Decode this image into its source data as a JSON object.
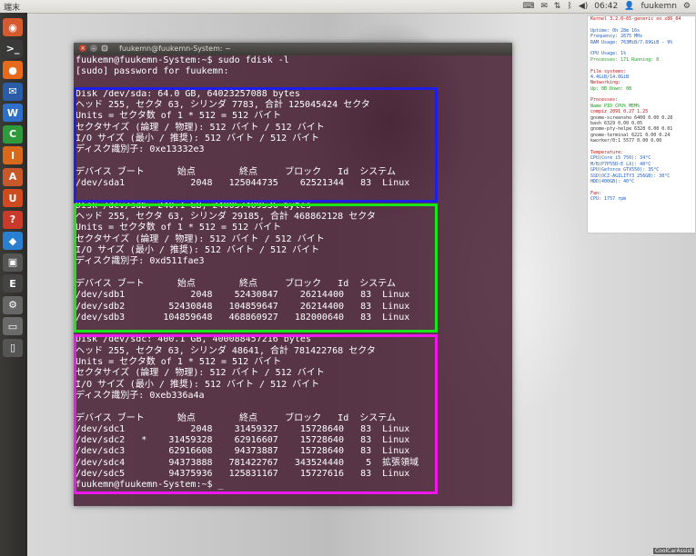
{
  "top_panel": {
    "app_title": "端末",
    "time": "06:42",
    "user": "fuukemn",
    "icons": [
      "keyboard-icon",
      "mail-icon",
      "network-icon",
      "bluetooth-icon",
      "volume-icon",
      "power-icon"
    ]
  },
  "launcher": {
    "items": [
      {
        "name": "dash-home",
        "glyph": "◉",
        "color": "#d65a2f"
      },
      {
        "name": "terminal",
        "glyph": ">_",
        "color": "#3a3a3a"
      },
      {
        "name": "firefox",
        "glyph": "●",
        "color": "#e66a1c"
      },
      {
        "name": "thunderbird",
        "glyph": "✉",
        "color": "#2a5ca8"
      },
      {
        "name": "writer",
        "glyph": "W",
        "color": "#2e6fc9"
      },
      {
        "name": "calc",
        "glyph": "C",
        "color": "#2e9a3c"
      },
      {
        "name": "impress",
        "glyph": "I",
        "color": "#d8691a"
      },
      {
        "name": "software-center",
        "glyph": "A",
        "color": "#c8582a"
      },
      {
        "name": "ubuntu-one",
        "glyph": "U",
        "color": "#d04a20"
      },
      {
        "name": "help",
        "glyph": "?",
        "color": "#c83a2a"
      },
      {
        "name": "dropbox",
        "glyph": "◆",
        "color": "#2a7fd0"
      },
      {
        "name": "screenshot",
        "glyph": "▣",
        "color": "#555555"
      },
      {
        "name": "editor",
        "glyph": "E",
        "color": "#444444"
      },
      {
        "name": "settings",
        "glyph": "⚙",
        "color": "#666666"
      },
      {
        "name": "drive",
        "glyph": "▭",
        "color": "#6a6a6a"
      },
      {
        "name": "trash",
        "glyph": "▯",
        "color": "#555555"
      }
    ]
  },
  "terminal": {
    "title": "fuukemn@fuukemn-System: ~",
    "lines": [
      "fuukemn@fuukemn-System:~$ sudo fdisk -l",
      "[sudo] password for fuukemn:",
      "",
      "Disk /dev/sda: 64.0 GB, 64023257088 bytes",
      "ヘッド 255, セクタ 63, シリンダ 7783, 合計 125045424 セクタ",
      "Units = セクタ数 of 1 * 512 = 512 バイト",
      "セクタサイズ (論理 / 物理): 512 バイト / 512 バイト",
      "I/O サイズ (最小 / 推奨): 512 バイト / 512 バイト",
      "ディスク識別子: 0xe13332e3",
      "",
      "デバイス ブート      始点        終点     ブロック   Id  システム",
      "/dev/sda1            2048   125044735    62521344   83  Linux",
      "",
      "Disk /dev/sdb: 240.1 GB, 240057409536 bytes",
      "ヘッド 255, セクタ 63, シリンダ 29185, 合計 468862128 セクタ",
      "Units = セクタ数 of 1 * 512 = 512 バイト",
      "セクタサイズ (論理 / 物理): 512 バイト / 512 バイト",
      "I/O サイズ (最小 / 推奨): 512 バイト / 512 バイト",
      "ディスク識別子: 0xd511fae3",
      "",
      "デバイス ブート      始点        終点     ブロック   Id  システム",
      "/dev/sdb1            2048    52430847    26214400   83  Linux",
      "/dev/sdb2        52430848   104859647    26214400   83  Linux",
      "/dev/sdb3       104859648   468860927   182000640   83  Linux",
      "",
      "Disk /dev/sdc: 400.1 GB, 400088457216 bytes",
      "ヘッド 255, セクタ 63, シリンダ 48641, 合計 781422768 セクタ",
      "Units = セクタ数 of 1 * 512 = 512 バイト",
      "セクタサイズ (論理 / 物理): 512 バイト / 512 バイト",
      "I/O サイズ (最小 / 推奨): 512 バイト / 512 バイト",
      "ディスク識別子: 0xeb336a4a",
      "",
      "デバイス ブート      始点        終点     ブロック   Id  システム",
      "/dev/sdc1            2048    31459327    15728640   83  Linux",
      "/dev/sdc2   *    31459328    62916607    15728640   83  Linux",
      "/dev/sdc3        62916608    94373887    15728640   83  Linux",
      "/dev/sdc4        94373888   781422767   343524440    5  拡張領域",
      "/dev/sdc5        94375936   125831167    15727616   83  Linux",
      "fuukemn@fuukemn-System:~$ _"
    ]
  },
  "conky": {
    "rows": [
      {
        "cls": "hdr",
        "text": "Kernel 3.2.0-65-generic on x86_64"
      },
      {
        "cls": "",
        "text": ""
      },
      {
        "cls": "lbl",
        "text": "Uptime:        0h 28m 16s"
      },
      {
        "cls": "lbl",
        "text": "Frequency:     2675 MHz"
      },
      {
        "cls": "lbl",
        "text": "RAM Usage:  763MiB/7.69GiB - 9%"
      },
      {
        "cls": "",
        "text": ""
      },
      {
        "cls": "lbl",
        "text": "CPU Usage: 1%"
      },
      {
        "cls": "grn",
        "text": "Processes: 171  Running: 0"
      },
      {
        "cls": "",
        "text": ""
      },
      {
        "cls": "hdr",
        "text": "File systems:"
      },
      {
        "cls": "lbl",
        "text": "  4.4GiB/14.0GiB"
      },
      {
        "cls": "hdr",
        "text": "Networking:"
      },
      {
        "cls": "grn",
        "text": "        Up: 0B   Down: 0B"
      },
      {
        "cls": "",
        "text": ""
      },
      {
        "cls": "hdr",
        "text": "Processes:"
      },
      {
        "cls": "grn",
        "text": "Name            PID  CPU%  MEM%"
      },
      {
        "cls": "hdr",
        "text": "compiz         2091  0.27  1.25"
      },
      {
        "cls": "",
        "text": "gnome-screensho 6400  0.00  0.28"
      },
      {
        "cls": "",
        "text": "bash            6329  0.00  0.05"
      },
      {
        "cls": "",
        "text": "gnome-pty-helpe 6328  0.00  0.01"
      },
      {
        "cls": "",
        "text": "gnome-terminal  6221  0.00  0.24"
      },
      {
        "cls": "",
        "text": "kworker/0:1     5577  0.00  0.00"
      },
      {
        "cls": "",
        "text": ""
      },
      {
        "cls": "hdr",
        "text": "Temperature:"
      },
      {
        "cls": "lbl",
        "text": "  CPU(Core i5 750):          34°C"
      },
      {
        "cls": "lbl",
        "text": "  M/B(P7P55D-E LX):          40°C"
      },
      {
        "cls": "lbl",
        "text": "  GPU(Geforce GTX550):       35°C"
      },
      {
        "cls": "lbl",
        "text": "  SSD(OCZ-AGILITY3 256GB):   30°C"
      },
      {
        "cls": "lbl",
        "text": "  HDD(400GB):                40°C"
      },
      {
        "cls": "",
        "text": ""
      },
      {
        "cls": "hdr",
        "text": "Fan:"
      },
      {
        "cls": "lbl",
        "text": "  CPU:                    1757 rpm"
      }
    ]
  },
  "watermark": "CoolCarAssist",
  "colors": {
    "highlight_sda": "#1e1ee8",
    "highlight_sdb": "#18e818",
    "highlight_sdc": "#ee18ee",
    "terminal_bg": "#40162c"
  }
}
